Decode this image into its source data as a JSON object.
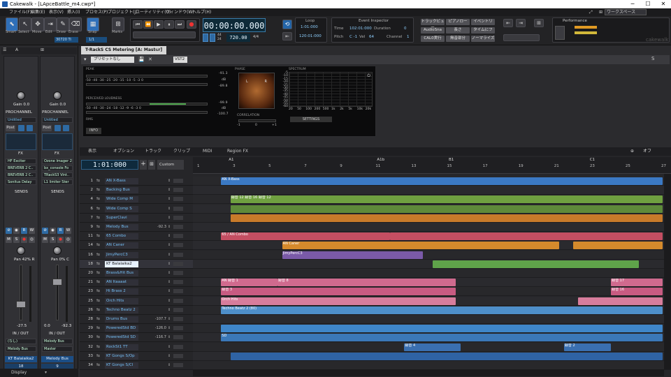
{
  "window": {
    "title": "Cakewalk - [LApceBattle_m4.cwp*]",
    "controls": [
      "─",
      "☐",
      "✕"
    ]
  },
  "menu": [
    "ファイル(F)",
    "編集(E)",
    "表示(V)",
    "挿入(I)",
    "プロセス(P)",
    "プロジェクト(J)",
    "ユーティリティ(U)",
    "ウィンドウ(W)",
    "ヘルプ(H)"
  ],
  "workspace": "ワークスペース",
  "tools": {
    "labels": [
      "Smart",
      "Select",
      "Move",
      "Edit",
      "Draw",
      "Erase"
    ],
    "snap_label": "Snap",
    "snap_value": "1/1",
    "marks_label": "Marks",
    "tool_value": "30720 Ti"
  },
  "transport": {
    "time": "00:00:00.000",
    "tempo": "720.00",
    "meter_top": "44",
    "meter_bottom": "24",
    "signature": "4/4"
  },
  "loop": {
    "label": "Loop",
    "start": "1:01:000",
    "end": "120:01:000"
  },
  "event_inspector": {
    "title": "Event Inspector",
    "time_label": "Time",
    "time_value": "102:01:000",
    "duration_label": "Duration",
    "duration_value": "0",
    "pitch_label": "Pitch",
    "pitch_value": "C -1",
    "vel_label": "Vel",
    "vel_value": "64",
    "channel_label": "Channel",
    "channel_value": "1"
  },
  "view_buttons": [
    "トラックビュー",
    "ピアノロー",
    "イベントリ",
    "AudioSna",
    "長さ",
    "タイムにフ",
    "CAL0実行",
    "無音部分",
    "ノーマライズ"
  ],
  "performance": {
    "label": "Performance",
    "brand": "cakewalk"
  },
  "plugin": {
    "tab": "T-RackS CS Metering [A: Master]",
    "preset": "プリセットなし",
    "vst": "VST2",
    "peak_label": "PEAK",
    "peak_scale": "-50 -40 -30 -25 -20 -15 -10  -5  -3  0",
    "peak_l": "-91.3",
    "peak_r": "-89.8",
    "db": "dB",
    "loud_label": "PERCEIVED LOUDNESS",
    "loud_scale": "-50 -40 -30 -24 -18 -12  -9  -6  -3  0",
    "loud_1": "-99.9",
    "loud_2": "-100.7",
    "rms_label": "RMS",
    "info_btn": "INFO",
    "phase_label": "PHASE",
    "correlation_label": "CORRELATION",
    "corr_min": "-1",
    "corr_zero": "0",
    "corr_max": "+1",
    "spectrum_label": "SPECTRUM",
    "spectrum_y": [
      "-5",
      "-10",
      "-15",
      "-20",
      "-25",
      "-30",
      "-35",
      "-40",
      "-45",
      "-50",
      "-55",
      "-60"
    ],
    "spectrum_x": [
      "20",
      "50",
      "100",
      "200",
      "500",
      "1k",
      "2k",
      "5k",
      "10k",
      "20k"
    ],
    "settings_btn": "SETTINGS"
  },
  "left_strips": [
    {
      "gain": "Gain 0.0",
      "prochannel": "PROCHANNEL",
      "preset": "Untitled",
      "post": "Post",
      "fx_title": "FX",
      "fx": [
        "HF Exciter",
        "BREVERB 2 C..",
        "BREVERB 2 C..",
        "Sonitus Delay"
      ],
      "sends": "SENDS",
      "pan": "Pan 42% R",
      "level": "-27.5",
      "io": "IN / OUT",
      "input": "(なし)",
      "output": "Melody Bus",
      "name": "KT Balalaika2",
      "number": "18"
    },
    {
      "gain": "Gain 0.0",
      "prochannel": "PROCHANNEL",
      "preset": "Untitled",
      "post": "Post",
      "fx_title": "FX",
      "fx": [
        "Ozone Imager 2",
        "bx_console Fo",
        "TRackS3 Vint..",
        "L1 limiter Ster"
      ],
      "sends": "SENDS",
      "pan": "Pan 0% C",
      "level_l": "0.0",
      "level_r": "-92.3",
      "io": "IN / OUT",
      "input": "Melody Bus",
      "output": "Master",
      "name": "Melody Bus",
      "number": "9"
    }
  ],
  "status": "Display",
  "track_menu": [
    "表示",
    "オプション",
    "トラック",
    "クリップ",
    "MIDI",
    "Region FX"
  ],
  "track_timecode": "1:01:000",
  "track_custom": "Custom",
  "track_view_off": "オフ",
  "ruler": {
    "ticks": [
      "1",
      "3",
      "5",
      "7",
      "9",
      "11",
      "13",
      "15",
      "17",
      "19",
      "21",
      "23",
      "25",
      "27"
    ],
    "markers": [
      "A1",
      "A1b",
      "B1",
      "C1"
    ]
  },
  "tracks": [
    {
      "num": "1",
      "name": "AN X-Bass",
      "val": ""
    },
    {
      "num": "2",
      "name": "Backing Bus",
      "val": ""
    },
    {
      "num": "4",
      "name": "Wide Comp M",
      "val": ""
    },
    {
      "num": "6",
      "name": "Wide Comp S",
      "val": ""
    },
    {
      "num": "7",
      "name": "SuperClavi",
      "val": ""
    },
    {
      "num": "9",
      "name": "Melody Bus",
      "val": "-92.3"
    },
    {
      "num": "11",
      "name": "65 Combo",
      "val": ""
    },
    {
      "num": "14",
      "name": "AN Caner",
      "val": ""
    },
    {
      "num": "16",
      "name": "JimyPercC3",
      "val": ""
    },
    {
      "num": "18",
      "name": "KT Balalaika2",
      "val": ""
    },
    {
      "num": "20",
      "name": "Brass&Hit Bus",
      "val": ""
    },
    {
      "num": "21",
      "name": "AN Itaaaat",
      "val": ""
    },
    {
      "num": "23",
      "name": "Hi Brass 2",
      "val": ""
    },
    {
      "num": "25",
      "name": "Orch Hits",
      "val": ""
    },
    {
      "num": "26",
      "name": "Techno Beatz 2",
      "val": ""
    },
    {
      "num": "28",
      "name": "Drums Bus",
      "val": "-107.7"
    },
    {
      "num": "29",
      "name": "PoweredStd BD",
      "val": "-126.0"
    },
    {
      "num": "30",
      "name": "PoweredStd SD",
      "val": "-116.7"
    },
    {
      "num": "32",
      "name": "RockSt1 TT",
      "val": ""
    },
    {
      "num": "33",
      "name": "KT Gongs S/Op",
      "val": ""
    },
    {
      "num": "34",
      "name": "KT Gongs S/Cl",
      "val": ""
    }
  ],
  "clips": [
    {
      "row": 0,
      "parts": [
        {
          "s": 0.06,
          "e": 1.0,
          "color": "#3b79c4",
          "label": "AN X-Bass"
        }
      ]
    },
    {
      "row": 2,
      "parts": [
        {
          "s": 0.08,
          "e": 1.0,
          "color": "#6fa040",
          "label": "録音 12  録音 16  録音 12"
        }
      ]
    },
    {
      "row": 3,
      "parts": [
        {
          "s": 0.08,
          "e": 1.0,
          "color": "#5e8a3a",
          "label": ""
        }
      ]
    },
    {
      "row": 4,
      "parts": [
        {
          "s": 0.08,
          "e": 1.0,
          "color": "#c77a2a",
          "label": ""
        }
      ]
    },
    {
      "row": 6,
      "parts": [
        {
          "s": 0.06,
          "e": 0.42,
          "color": "#c44e62",
          "label": "65 / AN Combo"
        },
        {
          "s": 0.42,
          "e": 1.0,
          "color": "#c44e62",
          "label": ""
        }
      ]
    },
    {
      "row": 7,
      "parts": [
        {
          "s": 0.19,
          "e": 0.78,
          "color": "#d58a2c",
          "label": "AN Caner"
        },
        {
          "s": 0.81,
          "e": 1.0,
          "color": "#d58a2c",
          "label": ""
        }
      ]
    },
    {
      "row": 8,
      "parts": [
        {
          "s": 0.19,
          "e": 0.49,
          "color": "#7a5aa8",
          "label": "JimyPercC3"
        }
      ]
    },
    {
      "row": 9,
      "parts": [
        {
          "s": 0.51,
          "e": 0.95,
          "color": "#5fa34a",
          "label": ""
        }
      ]
    },
    {
      "row": 11,
      "parts": [
        {
          "s": 0.06,
          "e": 0.18,
          "color": "#d06a8e",
          "label": "AN 録音 1"
        },
        {
          "s": 0.18,
          "e": 0.56,
          "color": "#d06a8e",
          "label": "録音 8"
        },
        {
          "s": 0.89,
          "e": 1.0,
          "color": "#d06a8e",
          "label": "録音 17"
        }
      ]
    },
    {
      "row": 12,
      "parts": [
        {
          "s": 0.06,
          "e": 0.56,
          "color": "#c85b82",
          "label": "録音 3"
        },
        {
          "s": 0.89,
          "e": 1.0,
          "color": "#c85b82",
          "label": "録音 16"
        }
      ]
    },
    {
      "row": 13,
      "parts": [
        {
          "s": 0.06,
          "e": 0.56,
          "color": "#d87d9c",
          "label": "Orch Hits"
        },
        {
          "s": 0.82,
          "e": 1.0,
          "color": "#d87d9c",
          "label": ""
        }
      ]
    },
    {
      "row": 14,
      "parts": [
        {
          "s": 0.06,
          "e": 1.0,
          "color": "#4e8fca",
          "label": "Techno Beatz 2 (80)"
        }
      ]
    },
    {
      "row": 16,
      "parts": [
        {
          "s": 0.06,
          "e": 1.0,
          "color": "#3f86c9",
          "label": ""
        }
      ]
    },
    {
      "row": 17,
      "parts": [
        {
          "s": 0.06,
          "e": 1.0,
          "color": "#3b78b8",
          "label": "SD"
        }
      ]
    },
    {
      "row": 18,
      "parts": [
        {
          "s": 0.45,
          "e": 0.57,
          "color": "#3a6fb0",
          "label": "録音 4"
        },
        {
          "s": 0.79,
          "e": 0.89,
          "color": "#3a6fb0",
          "label": "録音 2"
        }
      ]
    },
    {
      "row": 19,
      "parts": [
        {
          "s": 0.08,
          "e": 1.0,
          "color": "#2f63a4",
          "label": ""
        }
      ]
    }
  ]
}
